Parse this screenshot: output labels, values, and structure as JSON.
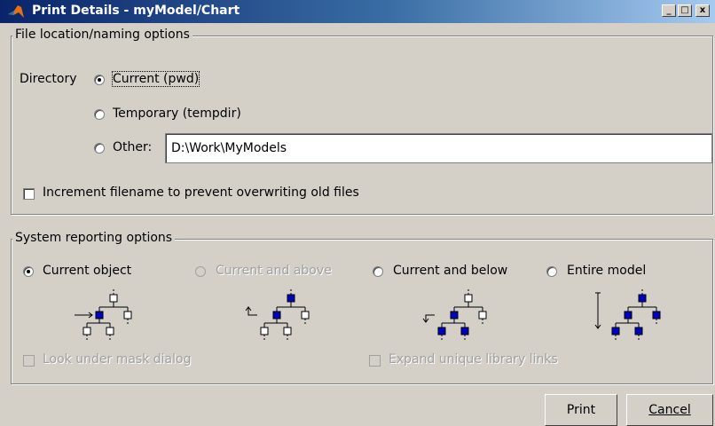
{
  "window": {
    "title": "Print Details - myModel/Chart",
    "minimize": "_",
    "maximize": "□",
    "close": "x"
  },
  "file_group": {
    "legend": "File location/naming options",
    "directory_label": "Directory",
    "options": [
      {
        "label": "Current (pwd)",
        "selected": true
      },
      {
        "label": "Temporary (tempdir)",
        "selected": false
      },
      {
        "label": "Other:",
        "selected": false
      }
    ],
    "other_path": "D:\\Work\\MyModels",
    "increment_label": "Increment filename to prevent overwriting old files",
    "increment_checked": false
  },
  "system_group": {
    "legend": "System reporting options",
    "scopes": [
      {
        "label": "Current object",
        "selected": true,
        "enabled": true
      },
      {
        "label": "Current and above",
        "selected": false,
        "enabled": false
      },
      {
        "label": "Current and below",
        "selected": false,
        "enabled": true
      },
      {
        "label": "Entire model",
        "selected": false,
        "enabled": true
      }
    ],
    "look_under_mask": "Look under mask dialog",
    "expand_library": "Expand unique library links"
  },
  "buttons": {
    "print": "Print",
    "cancel": "Cancel"
  },
  "colors": {
    "titlebar_start": "#0a246a",
    "titlebar_end": "#a6caf0",
    "dialog_bg": "#d4d0c8",
    "node_selected": "#0000c0"
  }
}
